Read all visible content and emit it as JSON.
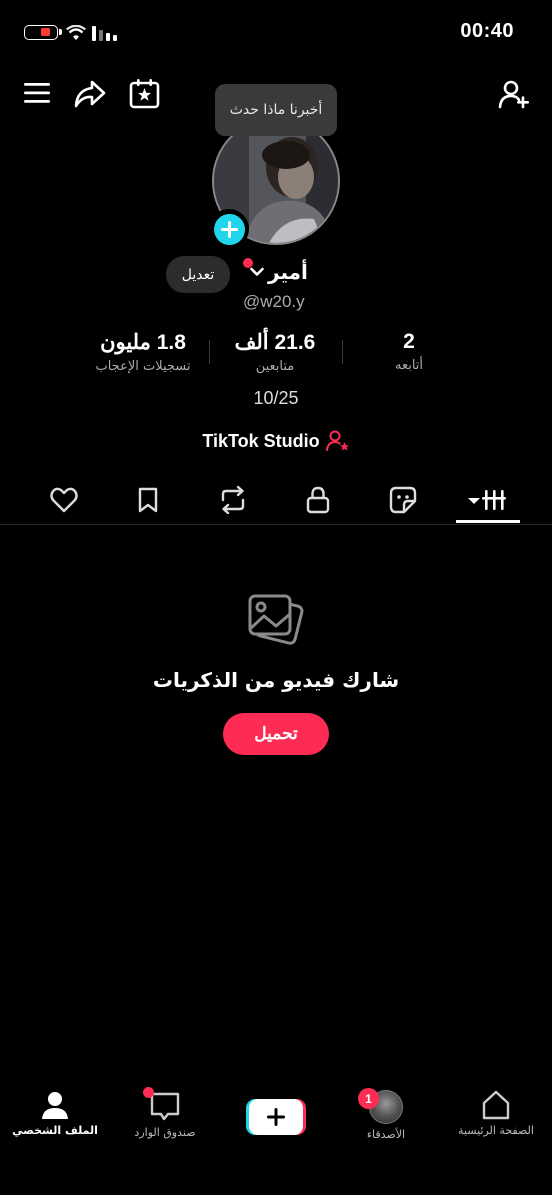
{
  "status_bar": {
    "time": "00:40"
  },
  "tooltip": {
    "text": "أخبرنا ماذا حدث"
  },
  "profile": {
    "name": "أمير",
    "handle": "@w20.y",
    "edit_label": "تعديل",
    "counter": "10/25",
    "studio_label": "TikTok Studio"
  },
  "stats": [
    {
      "value": "2",
      "label": "أتابعه"
    },
    {
      "value": "21.6 ألف",
      "label": "متابعين"
    },
    {
      "value": "1.8 مليون",
      "label": "تسجيلات الإعجاب"
    }
  ],
  "tabs": [
    "videos-grid",
    "stickers",
    "private",
    "reposts",
    "favorites",
    "liked"
  ],
  "empty_state": {
    "title": "شارك فيديو من الذكريات",
    "button": "تحميل"
  },
  "bottom_nav": {
    "home": "الصفحة الرئيسية",
    "friends": "الأصدقاء",
    "friends_badge": "1",
    "inbox": "صندوق الوارد",
    "profile": "الملف الشخصي"
  },
  "colors": {
    "accent": "#fe2c55",
    "cyan": "#20d5ec",
    "background": "#000000"
  }
}
